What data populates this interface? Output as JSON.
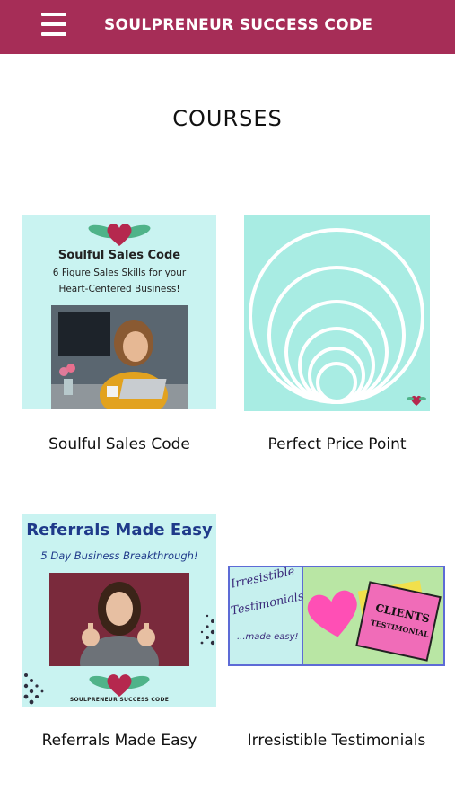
{
  "header": {
    "title": "SOULPRENEUR SUCCESS CODE",
    "menu_icon": "hamburger-menu-icon"
  },
  "page": {
    "title": "COURSES"
  },
  "courses": [
    {
      "label": "Soulful Sales Code",
      "thumb_title": "Soulful Sales Code",
      "thumb_sub1": "6 Figure Sales Skills for your",
      "thumb_sub2": "Heart-Centered Business!"
    },
    {
      "label": "Perfect Price Point"
    },
    {
      "label": "Referrals Made Easy",
      "thumb_title": "Referrals Made Easy",
      "thumb_sub": "5 Day Business Breakthrough!",
      "thumb_logo": "SOULPRENEUR SUCCESS CODE"
    },
    {
      "label": "Irresistible Testimonials",
      "thumb_line1": "Irresistible",
      "thumb_line2": "Testimonials",
      "thumb_line3": "...made easy!",
      "note_line1": "CLIENTS",
      "note_line2": "TESTIMONIAL"
    }
  ],
  "colors": {
    "header": "#a62d57",
    "accent_heart": "#b5284e",
    "leaf": "#4fb389"
  }
}
